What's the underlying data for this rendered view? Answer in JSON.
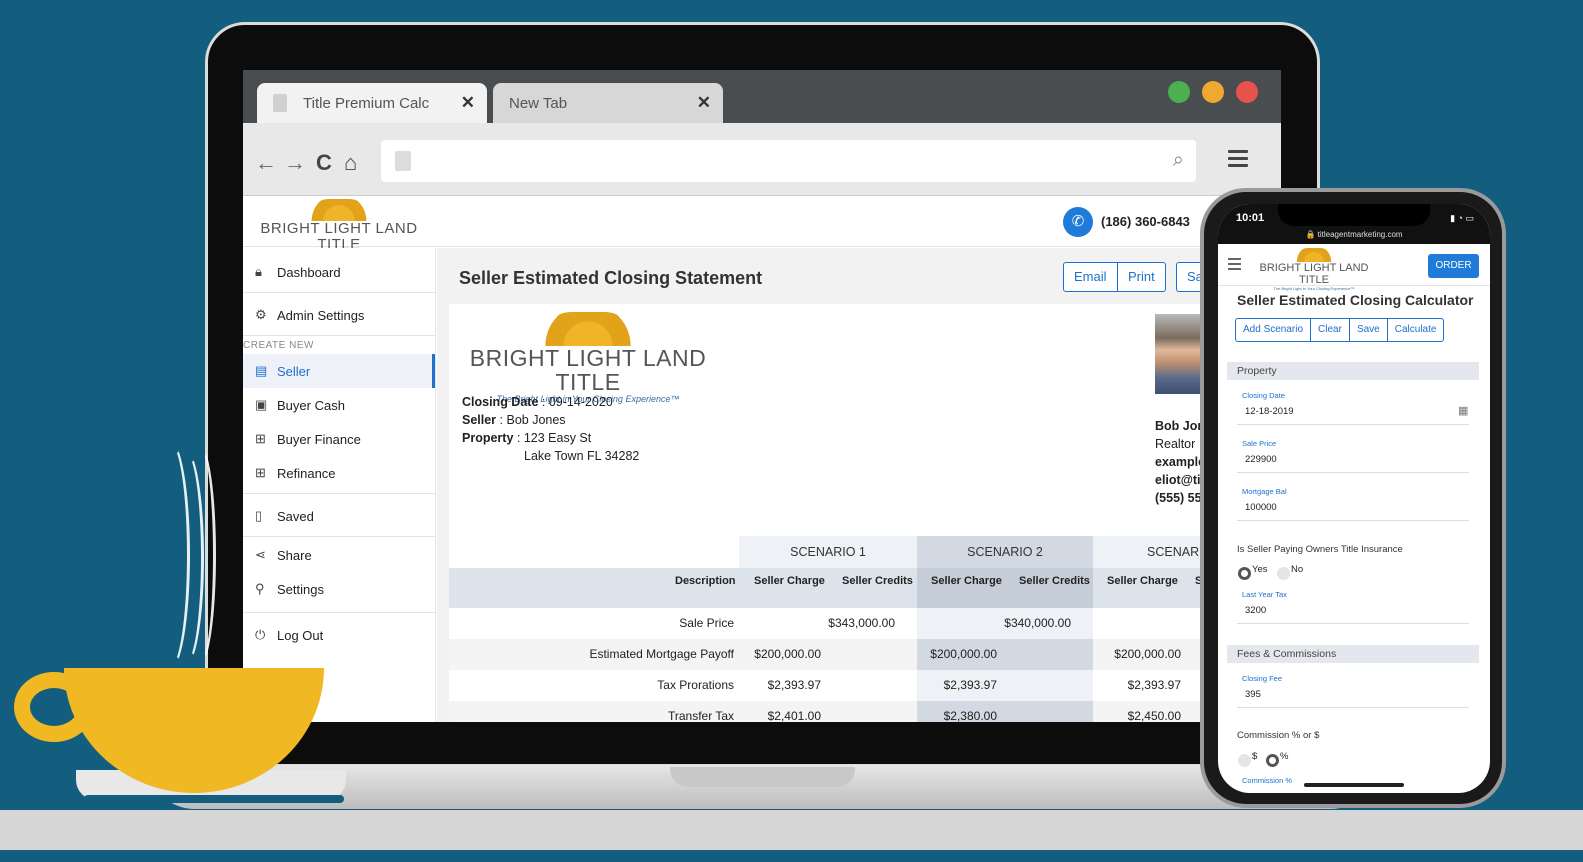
{
  "browser": {
    "tabs": [
      {
        "label": "Title Premium Calc",
        "close": "✕"
      },
      {
        "label": "New Tab",
        "close": "✕"
      }
    ],
    "window_dots": [
      "#4caf50",
      "#f0a930",
      "#e5534b"
    ]
  },
  "app": {
    "brand": {
      "name": "BRIGHT LIGHT LAND TITLE",
      "tagline": "The Bright Light in Your Closing Experience™"
    },
    "phone": "(186) 360-6843",
    "sidebar": {
      "items": [
        {
          "label": "Dashboard",
          "icon": "lock-icon"
        },
        {
          "label": "Admin Settings",
          "icon": "gear-icon"
        },
        {
          "label": "Seller",
          "icon": "building-icon"
        },
        {
          "label": "Buyer Cash",
          "icon": "cash-icon"
        },
        {
          "label": "Buyer Finance",
          "icon": "finance-icon"
        },
        {
          "label": "Refinance",
          "icon": "refinance-icon"
        },
        {
          "label": "Saved",
          "icon": "bookmark-icon"
        },
        {
          "label": "Share",
          "icon": "share-icon"
        },
        {
          "label": "Settings",
          "icon": "user-icon"
        },
        {
          "label": "Log Out",
          "icon": "power-icon"
        }
      ],
      "create_new_caption": "CREATE NEW"
    },
    "page_title": "Seller Estimated Closing Statement",
    "actions": {
      "email": "Email",
      "print": "Print",
      "save_partial": "Sa"
    },
    "statement": {
      "closing_date_label": "Closing Date",
      "closing_date": "09-14-2020",
      "seller_label": "Seller",
      "seller": "Bob Jones",
      "property_label": "Property",
      "property_line1": "123 Easy St",
      "property_line2": "Lake Town FL 34282"
    },
    "agent": {
      "name": "Bob Jon",
      "title": "Realtor",
      "company": "example",
      "email": "eliot@tit",
      "phone": "(555) 55"
    },
    "table": {
      "scenarios": [
        "SCENARIO 1",
        "SCENARIO 2",
        "SCENARIO"
      ],
      "headers": {
        "description": "Description",
        "seller_charge": "Seller Charge",
        "seller_credits": "Seller Credits",
        "seller_charge_partial": "S"
      },
      "rows": [
        {
          "desc": "Sale Price",
          "s1c": "",
          "s1cr": "$343,000.00",
          "s2c": "",
          "s2cr": "$340,000.00",
          "s3c": "$"
        },
        {
          "desc": "Estimated Mortgage Payoff",
          "s1c": "$200,000.00",
          "s1cr": "",
          "s2c": "$200,000.00",
          "s2cr": "",
          "s3c": "$200,000.00"
        },
        {
          "desc": "Tax Prorations",
          "s1c": "$2,393.97",
          "s1cr": "",
          "s2c": "$2,393.97",
          "s2cr": "",
          "s3c": "$2,393.97"
        },
        {
          "desc": "Transfer Tax",
          "s1c": "$2,401.00",
          "s1cr": "",
          "s2c": "$2,380.00",
          "s2cr": "",
          "s3c": "$2,450.00"
        }
      ]
    }
  },
  "phone": {
    "time": "10:01",
    "url": "🔒 titleagentmarketing.com",
    "order": "ORDER",
    "title": "Seller Estimated Closing Calculator",
    "buttons": [
      "Add Scenario",
      "Clear",
      "Save",
      "Calculate"
    ],
    "sections": {
      "property": "Property",
      "fees": "Fees & Commissions"
    },
    "fields": {
      "closing_date_label": "Closing Date",
      "closing_date": "12-18-2019",
      "sale_price_label": "Sale Price",
      "sale_price": "229900",
      "mortgage_label": "Mortgage Bal",
      "mortgage": "100000",
      "owners_q": "Is Seller Paying Owners Title Insurance",
      "yes": "Yes",
      "no": "No",
      "last_tax_label": "Last Year Tax",
      "last_tax": "3200",
      "closing_fee_label": "Closing Fee",
      "closing_fee": "395",
      "commission_q": "Commission % or $",
      "dollar": "$",
      "percent": "%",
      "commission_pct_label": "Commission %"
    }
  }
}
